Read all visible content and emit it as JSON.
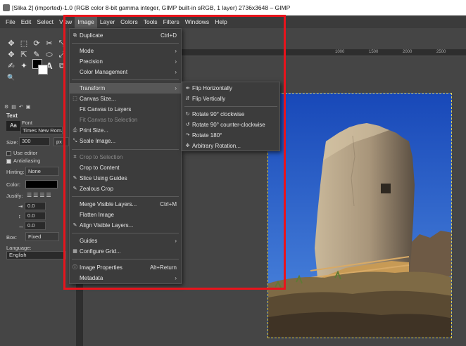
{
  "window": {
    "title": "[Slika 2] (imported)-1.0 (RGB color 8-bit gamma integer, GIMP built-in sRGB, 1 layer) 2736x3648 – GIMP"
  },
  "menubar": {
    "items": [
      "File",
      "Edit",
      "Select",
      "View",
      "Image",
      "Layer",
      "Colors",
      "Tools",
      "Filters",
      "Windows",
      "Help"
    ],
    "active": "Image"
  },
  "toolbox": {
    "tools": [
      "✥",
      "⬚",
      "⟳",
      "✂",
      "⤡",
      "✥",
      "⇱",
      "✎",
      "⬭",
      "⤢",
      "✍",
      "✦",
      "⌖",
      "A",
      "⧉",
      "🔍"
    ],
    "options_title": "Text",
    "font_label": "Font",
    "font_box": "Aa",
    "font_value": "Times New Roman",
    "size_label": "Size:",
    "size_value": "300",
    "size_unit": "px",
    "use_editor": "Use editor",
    "antialiasing": "Antialiasing",
    "hinting_label": "Hinting:",
    "hinting_value": "None",
    "color_label": "Color:",
    "justify_label": "Justify:",
    "indent_value": "0.0",
    "line_spacing_value": "0.0",
    "letter_spacing_value": "0.0",
    "box_label": "Box:",
    "box_value": "Fixed",
    "language_label": "Language:",
    "language_value": "English"
  },
  "ruler": {
    "labels": [
      "1000",
      "1500",
      "2000",
      "2500"
    ]
  },
  "image_menu": {
    "items": [
      {
        "label": "Duplicate",
        "shortcut": "Ctrl+D",
        "icon": "duplicate-icon",
        "glyph": "⧉"
      },
      {
        "label": "Mode",
        "submenu": true
      },
      {
        "label": "Precision",
        "submenu": true
      },
      {
        "label": "Color Management",
        "submenu": true
      },
      {
        "label": "Transform",
        "submenu": true,
        "highlighted": true
      },
      {
        "label": "Canvas Size...",
        "icon": "canvas-size-icon",
        "glyph": "⬚"
      },
      {
        "label": "Fit Canvas to Layers"
      },
      {
        "label": "Fit Canvas to Selection",
        "disabled": true
      },
      {
        "label": "Print Size...",
        "icon": "print-icon",
        "glyph": "⎙"
      },
      {
        "label": "Scale Image...",
        "icon": "scale-icon",
        "glyph": "⤡"
      },
      {
        "label": "Crop to Selection",
        "disabled": true,
        "icon": "crop-icon",
        "glyph": "⌗"
      },
      {
        "label": "Crop to Content"
      },
      {
        "label": "Slice Using Guides",
        "icon": "slice-icon",
        "glyph": "✎"
      },
      {
        "label": "Zealous Crop",
        "icon": "zealous-crop-icon",
        "glyph": "✎"
      },
      {
        "label": "Merge Visible Layers...",
        "shortcut": "Ctrl+M"
      },
      {
        "label": "Flatten Image"
      },
      {
        "label": "Align Visible Layers...",
        "icon": "align-icon",
        "glyph": "✎"
      },
      {
        "label": "Guides",
        "submenu": true
      },
      {
        "label": "Configure Grid...",
        "icon": "grid-icon",
        "glyph": "▦"
      },
      {
        "label": "Image Properties",
        "shortcut": "Alt+Return",
        "icon": "info-icon",
        "glyph": "ⓘ"
      },
      {
        "label": "Metadata",
        "submenu": true
      }
    ]
  },
  "transform_submenu": {
    "items": [
      {
        "label": "Flip Horizontally",
        "icon": "flip-horizontal-icon",
        "glyph": "⇹"
      },
      {
        "label": "Flip Vertically",
        "icon": "flip-vertical-icon",
        "glyph": "⇵"
      },
      {
        "label": "Rotate 90° clockwise",
        "icon": "rotate-cw-icon",
        "glyph": "↻"
      },
      {
        "label": "Rotate 90° counter-clockwise",
        "icon": "rotate-ccw-icon",
        "glyph": "↺"
      },
      {
        "label": "Rotate 180°",
        "icon": "rotate-180-icon",
        "glyph": "↷"
      },
      {
        "label": "Arbitrary Rotation...",
        "icon": "arbitrary-rotation-icon",
        "glyph": "✥"
      }
    ]
  },
  "colors": {
    "highlight_box": "#e8141c",
    "menu_bg": "#3c3c3c",
    "menu_highlight": "#575757"
  }
}
